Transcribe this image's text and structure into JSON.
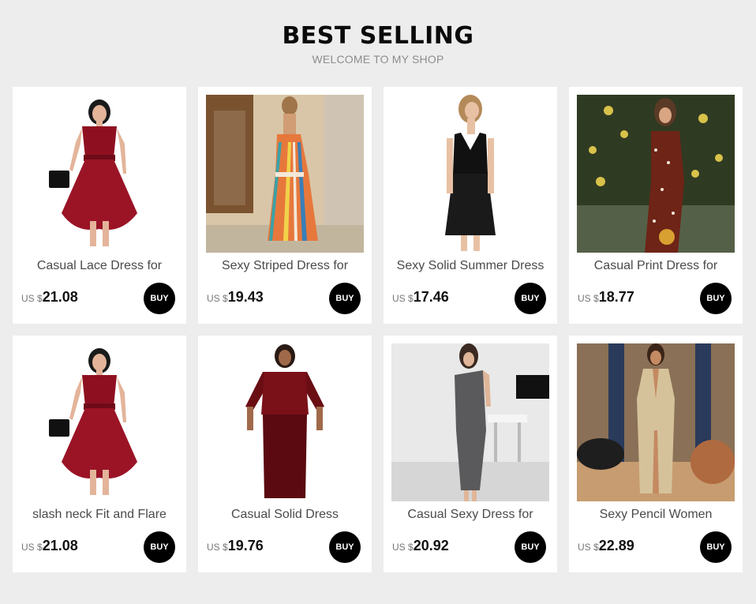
{
  "header": {
    "title": "BEST SELLING",
    "subtitle": "WELCOME TO MY SHOP"
  },
  "products": [
    {
      "name": "Casual Lace Dress for",
      "currency": "US $",
      "price": "21.08",
      "buy_label": "BUY",
      "image": "burgundy-lace-dress"
    },
    {
      "name": "Sexy Striped Dress for",
      "currency": "US $",
      "price": "19.43",
      "buy_label": "BUY",
      "image": "striped-maxi-dress"
    },
    {
      "name": "Sexy Solid Summer Dress",
      "currency": "US $",
      "price": "17.46",
      "buy_label": "BUY",
      "image": "black-slip-dress"
    },
    {
      "name": "Casual Print Dress for",
      "currency": "US $",
      "price": "18.77",
      "buy_label": "BUY",
      "image": "polka-dot-dress"
    },
    {
      "name": "slash neck Fit and Flare",
      "currency": "US $",
      "price": "21.08",
      "buy_label": "BUY",
      "image": "burgundy-lace-dress"
    },
    {
      "name": "Casual Solid Dress",
      "currency": "US $",
      "price": "19.76",
      "buy_label": "BUY",
      "image": "plus-size-maxi-dress"
    },
    {
      "name": "Casual Sexy Dress for",
      "currency": "US $",
      "price": "20.92",
      "buy_label": "BUY",
      "image": "grey-one-shoulder-dress"
    },
    {
      "name": "Sexy Pencil Women",
      "currency": "US $",
      "price": "22.89",
      "buy_label": "BUY",
      "image": "gold-sequin-dress"
    }
  ],
  "colors": {
    "background": "#ededed",
    "card": "#ffffff",
    "buy_button": "#000000"
  }
}
